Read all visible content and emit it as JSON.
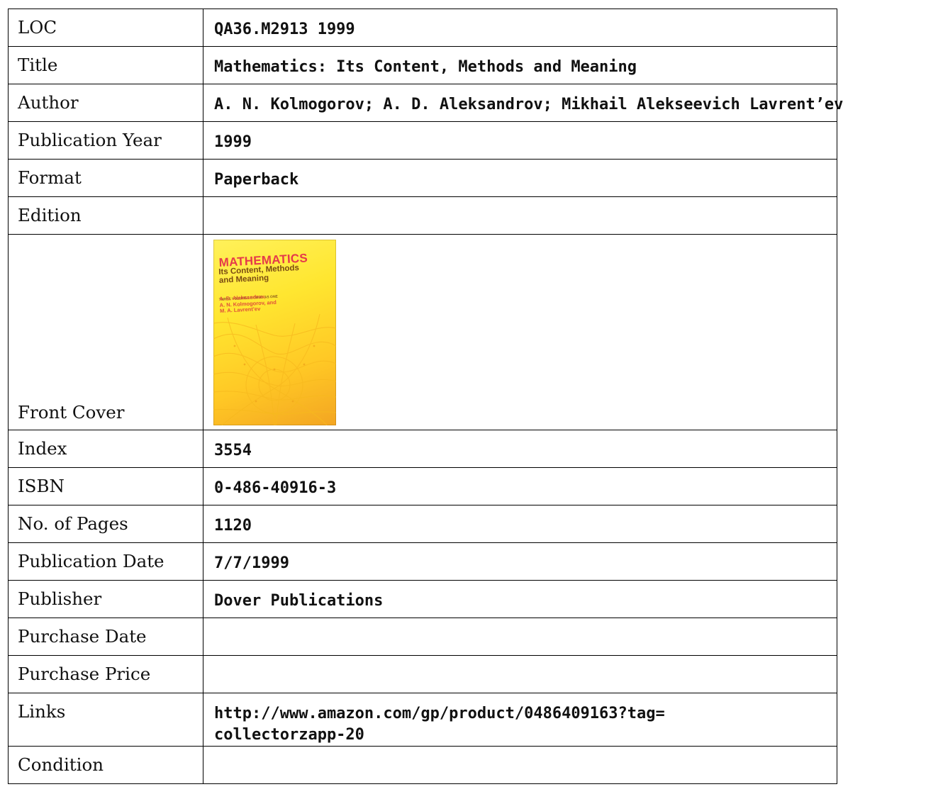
{
  "rows": [
    {
      "label": "LOC",
      "value": "QA36.M2913 1999"
    },
    {
      "label": "Title",
      "value": "Mathematics: Its Content, Methods and Meaning"
    },
    {
      "label": "Author",
      "value": "A. N. Kolmogorov; A. D. Aleksandrov; Mikhail Alekseevich Lavrent’ev"
    },
    {
      "label": "Publication Year",
      "value": "1999"
    },
    {
      "label": "Format",
      "value": "Paperback"
    },
    {
      "label": "Edition",
      "value": ""
    },
    {
      "label": "Front Cover",
      "value": ""
    },
    {
      "label": "Index",
      "value": "3554"
    },
    {
      "label": "ISBN",
      "value": "0-486-40916-3"
    },
    {
      "label": "No. of Pages",
      "value": "1120"
    },
    {
      "label": "Publication Date",
      "value": "7/7/1999"
    },
    {
      "label": "Publisher",
      "value": "Dover Publications"
    },
    {
      "label": "Purchase Date",
      "value": ""
    },
    {
      "label": "Purchase Price",
      "value": ""
    },
    {
      "label": "Links",
      "value_line1": "http://www.amazon.com/gp/product/0486409163?tag=",
      "value_line2": "collectorzapp-20"
    },
    {
      "label": "Condition",
      "value": ""
    }
  ],
  "cover": {
    "title": "MATHEMATICS",
    "subtitle_line1": "Its Content, Methods",
    "subtitle_line2": "and Meaning",
    "tagline": "THREE VOLUMES BOUND AS ONE",
    "author_line1": "A. D. Aleksandrov,",
    "author_line2": "A. N. Kolmogorov, and",
    "author_line3": "M. A. Lavrent’ev",
    "colors": {
      "background": "#ffe630",
      "title": "#e53a4a",
      "authors": "#e0503a"
    }
  }
}
